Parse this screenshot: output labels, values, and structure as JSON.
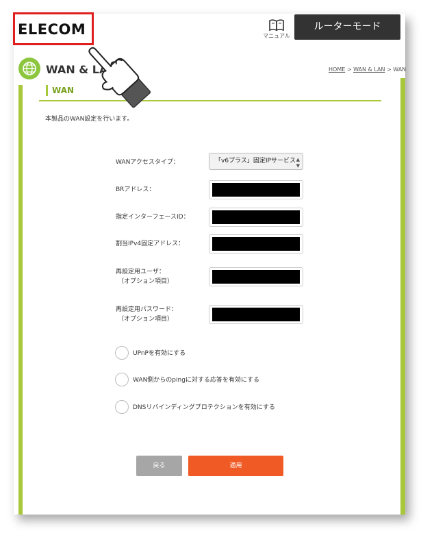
{
  "header": {
    "logo": "ELECOM",
    "manual_label": "マニュアル",
    "mode_button": "ルーターモード"
  },
  "page": {
    "title": "WAN & LAN",
    "breadcrumb": {
      "home": "HOME",
      "sep1": " > ",
      "wanlan": "WAN & LAN",
      "sep2": " > ",
      "current": "WAN"
    }
  },
  "section": {
    "title": "WAN",
    "description": "本製品のWAN設定を行います。"
  },
  "form": {
    "wan_access_type_label": "WANアクセスタイプ：",
    "wan_access_type_value": "「v6プラス」固定IPサービス",
    "br_address_label": "BRアドレス：",
    "interface_id_label": "指定インターフェースID：",
    "ipv4_label": "割当IPv4固定アドレス：",
    "user_label": "再設定用ユーザ：",
    "user_sub": "（オプション項目）",
    "password_label": "再設定用パスワード：",
    "password_sub": "（オプション項目）"
  },
  "options": [
    {
      "label": "UPnPを有効にする"
    },
    {
      "label": "WAN側からのpingに対する応答を有効にする"
    },
    {
      "label": "DNSリバインディングプロテクションを有効にする"
    }
  ],
  "buttons": {
    "back": "戻る",
    "apply": "適用"
  },
  "colors": {
    "accent_green": "#a8c73b",
    "apply_orange": "#f05a24",
    "highlight_red": "#e01e1e"
  }
}
